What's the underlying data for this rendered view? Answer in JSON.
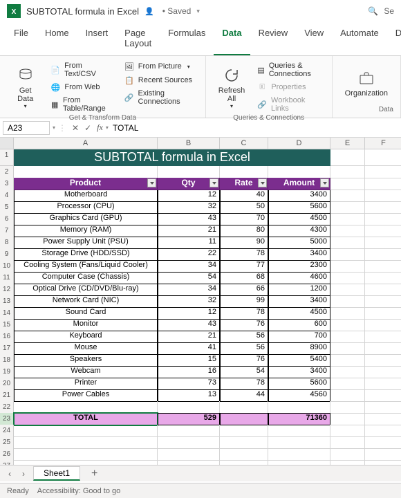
{
  "titlebar": {
    "doc_title": "SUBTOTAL formula in Excel",
    "saved": "• Saved",
    "search_placeholder": "Se"
  },
  "menu": {
    "tabs": [
      "File",
      "Home",
      "Insert",
      "Page Layout",
      "Formulas",
      "Data",
      "Review",
      "View",
      "Automate",
      "Developer"
    ],
    "active": "Data"
  },
  "ribbon": {
    "get_data": "Get Data",
    "from_text_csv": "From Text/CSV",
    "from_web": "From Web",
    "from_table_range": "From Table/Range",
    "from_picture": "From Picture",
    "recent_sources": "Recent Sources",
    "existing_connections": "Existing Connections",
    "group1_label": "Get & Transform Data",
    "refresh_all": "Refresh All",
    "queries_connections": "Queries & Connections",
    "properties": "Properties",
    "workbook_links": "Workbook Links",
    "group2_label": "Queries & Connections",
    "organization": "Organization",
    "group3_label": "Data"
  },
  "namebox": {
    "ref": "A23",
    "formula": "TOTAL"
  },
  "columns": [
    "A",
    "B",
    "C",
    "D",
    "E",
    "F"
  ],
  "sheet_title": "SUBTOTAL formula in Excel",
  "headers": {
    "product": "Product",
    "qty": "Qty",
    "rate": "Rate",
    "amount": "Amount"
  },
  "rows": [
    {
      "n": 4,
      "product": "Motherboard",
      "qty": 12,
      "rate": 40,
      "amount": 3400
    },
    {
      "n": 5,
      "product": "Processor (CPU)",
      "qty": 32,
      "rate": 50,
      "amount": 5600
    },
    {
      "n": 6,
      "product": "Graphics Card (GPU)",
      "qty": 43,
      "rate": 70,
      "amount": 4500
    },
    {
      "n": 7,
      "product": "Memory (RAM)",
      "qty": 21,
      "rate": 80,
      "amount": 4300
    },
    {
      "n": 8,
      "product": "Power Supply Unit (PSU)",
      "qty": 11,
      "rate": 90,
      "amount": 5000
    },
    {
      "n": 9,
      "product": "Storage Drive (HDD/SSD)",
      "qty": 22,
      "rate": 78,
      "amount": 3400
    },
    {
      "n": 10,
      "product": "Cooling System (Fans/Liquid Cooler)",
      "qty": 34,
      "rate": 77,
      "amount": 2300
    },
    {
      "n": 11,
      "product": "Computer Case (Chassis)",
      "qty": 54,
      "rate": 68,
      "amount": 4600
    },
    {
      "n": 12,
      "product": "Optical Drive (CD/DVD/Blu-ray)",
      "qty": 34,
      "rate": 66,
      "amount": 1200
    },
    {
      "n": 13,
      "product": "Network Card (NIC)",
      "qty": 32,
      "rate": 99,
      "amount": 3400
    },
    {
      "n": 14,
      "product": "Sound Card",
      "qty": 12,
      "rate": 78,
      "amount": 4500
    },
    {
      "n": 15,
      "product": "Monitor",
      "qty": 43,
      "rate": 76,
      "amount": 600
    },
    {
      "n": 16,
      "product": "Keyboard",
      "qty": 21,
      "rate": 56,
      "amount": 700
    },
    {
      "n": 17,
      "product": "Mouse",
      "qty": 41,
      "rate": 56,
      "amount": 8900
    },
    {
      "n": 18,
      "product": "Speakers",
      "qty": 15,
      "rate": 76,
      "amount": 5400
    },
    {
      "n": 19,
      "product": "Webcam",
      "qty": 16,
      "rate": 54,
      "amount": 3400
    },
    {
      "n": 20,
      "product": "Printer",
      "qty": 73,
      "rate": 78,
      "amount": 5600
    },
    {
      "n": 21,
      "product": "Power Cables",
      "qty": 13,
      "rate": 44,
      "amount": 4560
    }
  ],
  "totals": {
    "label": "TOTAL",
    "qty": 529,
    "rate": "",
    "amount": 71360
  },
  "empty_row_nums": [
    24,
    25,
    26,
    27
  ],
  "sheet_tab": "Sheet1",
  "status": {
    "ready": "Ready",
    "access": "Accessibility: Good to go"
  }
}
